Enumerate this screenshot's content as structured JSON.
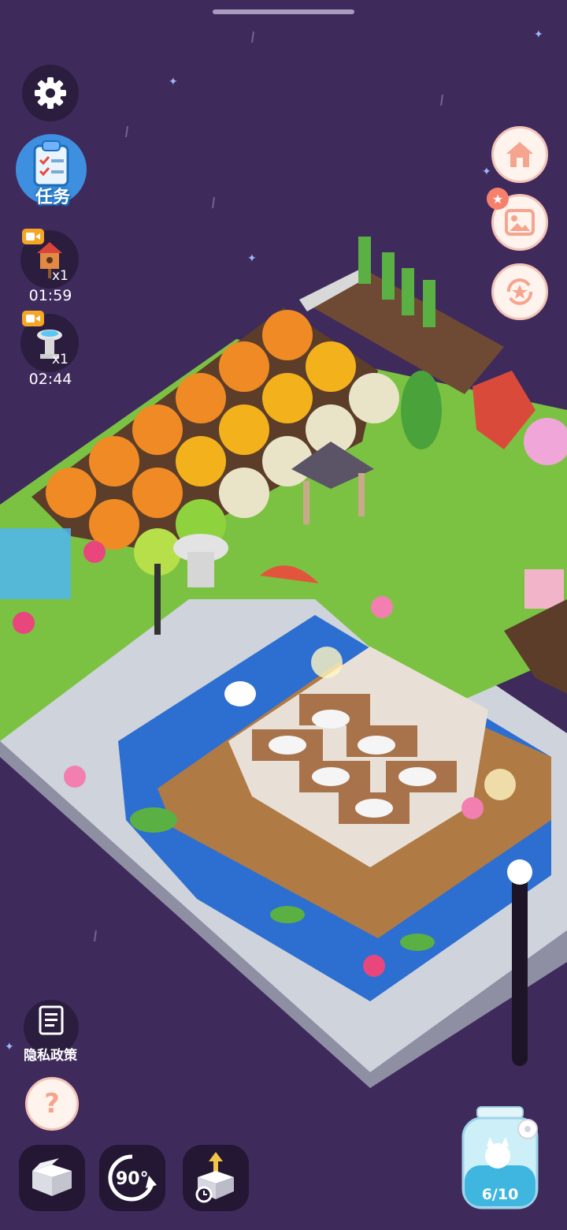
{
  "top_left": {
    "settings_icon": "gear-icon",
    "missions": {
      "label": "任务",
      "icon": "clipboard-checklist-icon"
    },
    "boosts": [
      {
        "icon": "birdhouse-icon",
        "badge": "video-ad-icon",
        "count": "x1",
        "timer": "01:59"
      },
      {
        "icon": "fountain-icon",
        "badge": "video-ad-icon",
        "count": "x1",
        "timer": "02:44"
      }
    ]
  },
  "right_buttons": [
    {
      "icon": "home-icon"
    },
    {
      "icon": "gallery-icon",
      "badge": "star-badge-icon"
    },
    {
      "icon": "star-rotate-icon"
    }
  ],
  "zoom_slider": {
    "level": 0.0
  },
  "bottom_left": {
    "privacy": {
      "label": "隐私政策",
      "icon": "document-icon"
    },
    "help_icon": "question-mark-icon"
  },
  "toolbar": [
    {
      "icon": "storage-box-icon"
    },
    {
      "icon": "rotate-90-icon",
      "label": "90°"
    },
    {
      "icon": "place-item-icon"
    }
  ],
  "jar": {
    "count": "6/10",
    "icon": "fairy-jar-icon"
  },
  "colors": {
    "background": "#3f2a5c",
    "grass": "#7cc242",
    "water": "#2d6fd0",
    "stone": "#cfd3dc",
    "accent_orange": "#f08a24"
  }
}
